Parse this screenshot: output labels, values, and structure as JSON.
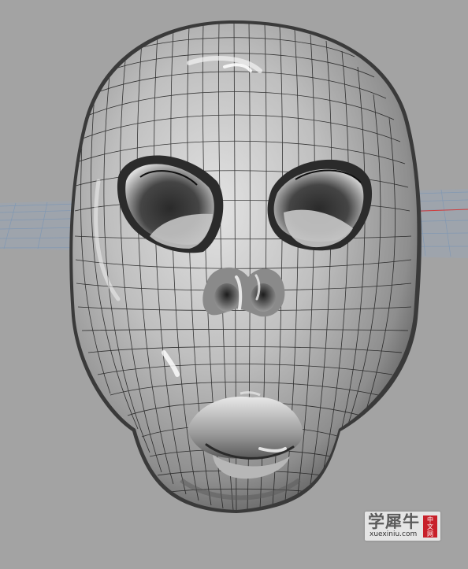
{
  "viewport": {
    "background_color": "#a3a3a3",
    "grid_color": "#7e97b4",
    "mesh_color": "#1a1a1a",
    "surface_highlight": "#f4f4f4",
    "surface_shadow": "#2a2a2a"
  },
  "model": {
    "subject": "alien mask mesh"
  },
  "watermark": {
    "brand": "学犀牛",
    "url": "xuexiniu.com",
    "seal": [
      "中",
      "文",
      "网"
    ],
    "seal_color": "#c8202a"
  }
}
